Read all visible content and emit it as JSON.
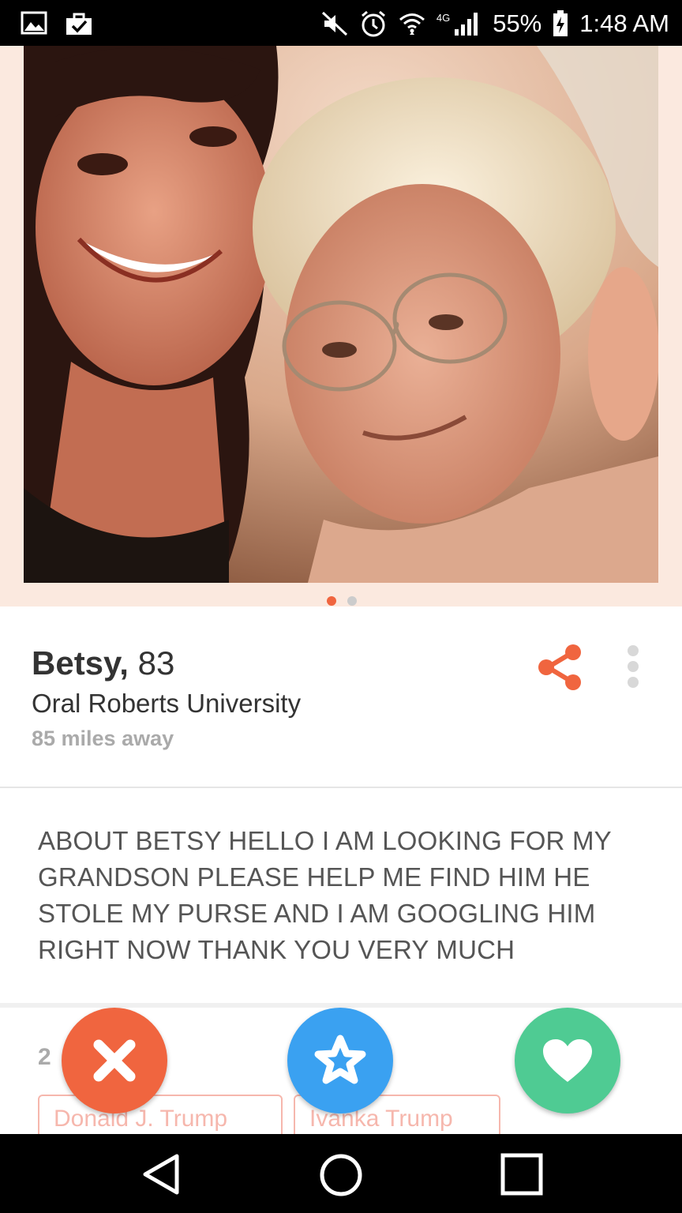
{
  "status_bar": {
    "icons_left": [
      "image-icon",
      "shopping-bag-check-icon"
    ],
    "icons_right": [
      "mute-icon",
      "alarm-icon",
      "wifi-icon",
      "signal-icon",
      "battery-charging-icon"
    ],
    "network": "4G",
    "battery": "55%",
    "time": "1:48 AM"
  },
  "photo": {
    "description_icon": "profile-photo",
    "page_dots": 2,
    "active_dot": 0,
    "active_color": "#f0653f",
    "inactive_color": "#cccccc"
  },
  "profile": {
    "name": "Betsy,",
    "age": "83",
    "school": "Oral Roberts University",
    "distance": "85 miles away"
  },
  "about": {
    "text": "ABOUT BETSY HELLO I AM LOOKING FOR MY GRANDSON PLEASE HELP ME FIND HIM HE STOLE MY PURSE AND I AM GOOGLING HIM RIGHT NOW THANK YOU VERY MUCH"
  },
  "common": {
    "count": "2",
    "chips": [
      "Donald J. Trump",
      "Ivanka Trump"
    ]
  },
  "actions": {
    "nope_color": "#f0653f",
    "superlike_color": "#3aa1f1",
    "like_color": "#4fcb93"
  },
  "colors": {
    "accent": "#f0653f"
  }
}
